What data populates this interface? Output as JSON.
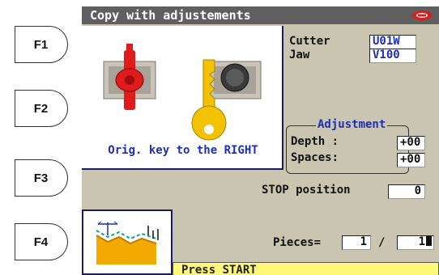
{
  "function_keys": [
    "F1",
    "F2",
    "F3",
    "F4"
  ],
  "window": {
    "title": "Copy with adjustements",
    "logo": "silca-logo"
  },
  "key_panel": {
    "caption": "Orig. key to the RIGHT"
  },
  "cutter": {
    "label": "Cutter",
    "value": "U01W"
  },
  "jaw": {
    "label": "Jaw",
    "value": "V100"
  },
  "adjustment": {
    "title": "Adjustment",
    "depth_label": "Depth :",
    "depth_value": "+00",
    "spaces_label": "Spaces:",
    "spaces_value": "+00"
  },
  "stop": {
    "label": "STOP position",
    "value": "0"
  },
  "pieces": {
    "label": "Pieces=",
    "done": "1",
    "separator": "/",
    "total": "1"
  },
  "status": {
    "message": "Press START"
  },
  "colors": {
    "screen_bg": "#c9c5b0",
    "title_bg": "#5f5f5f",
    "accent_blue": "#1d2fb8",
    "status_bg": "#fff87a",
    "key_yellow": "#f2c200",
    "clamp_red": "#e01b1b"
  }
}
